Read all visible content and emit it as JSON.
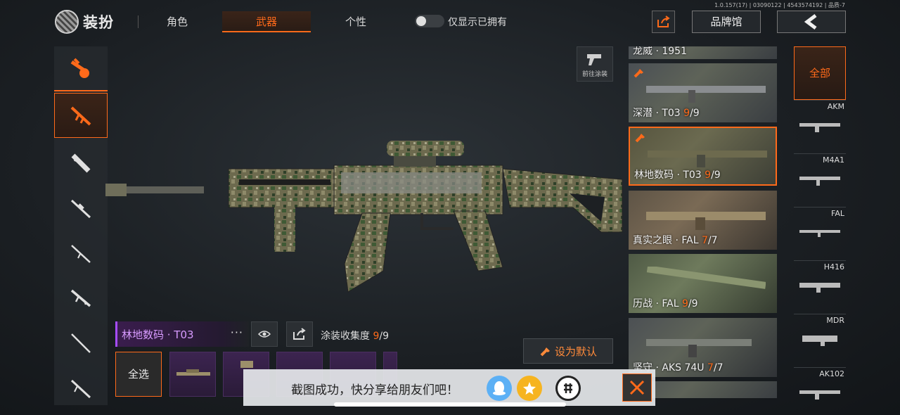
{
  "version": "1.0.157(17) | 03090122 | 4543574192 | 品质-7",
  "header": {
    "title": "装扮",
    "tabs": [
      {
        "label": "角色",
        "active": false
      },
      {
        "label": "武器",
        "active": true
      },
      {
        "label": "个性",
        "active": false
      }
    ],
    "toggle_label": "仅显示已拥有",
    "toggle_on": false,
    "brand_label": "品牌馆"
  },
  "categories": [
    {
      "icon": "skin-theme-icon",
      "active": false
    },
    {
      "icon": "assault-rifle-icon",
      "active": true
    },
    {
      "icon": "smg-icon",
      "active": false
    },
    {
      "icon": "sniper-rifle-icon",
      "active": false
    },
    {
      "icon": "marksman-rifle-icon",
      "active": false
    },
    {
      "icon": "shotgun-icon",
      "active": false
    },
    {
      "icon": "rifle-icon",
      "active": false
    },
    {
      "icon": "lmg-icon",
      "active": false
    }
  ],
  "goto_paint_label": "前往涂装",
  "selected_skin": {
    "name": "林地数码 · T03",
    "more": "···",
    "collection_label": "涂装收集度",
    "collected": "9",
    "total": "/9"
  },
  "set_default_label": "设为默认",
  "select_all_label": "全选",
  "skins": [
    {
      "label": "龙威 · 1951",
      "count": "",
      "total": ""
    },
    {
      "label": "深潜 · T03 ",
      "count": "9",
      "total": "/9"
    },
    {
      "label": "林地数码 · T03 ",
      "count": "9",
      "total": "/9",
      "selected": true
    },
    {
      "label": "真实之眼 · FAL ",
      "count": "7",
      "total": "/7"
    },
    {
      "label": "历战 · FAL ",
      "count": "9",
      "total": "/9"
    },
    {
      "label": "坚守 · AKS 74U ",
      "count": "7",
      "total": "/7"
    }
  ],
  "weapon_filter": {
    "all_label": "全部",
    "items": [
      "AKM",
      "M4A1",
      "FAL",
      "H416",
      "MDR",
      "AK102"
    ]
  },
  "toast": {
    "message": "截图成功，快分享给朋友们吧！"
  },
  "colors": {
    "accent": "#ff6a1a",
    "epic": "#a64dff"
  }
}
